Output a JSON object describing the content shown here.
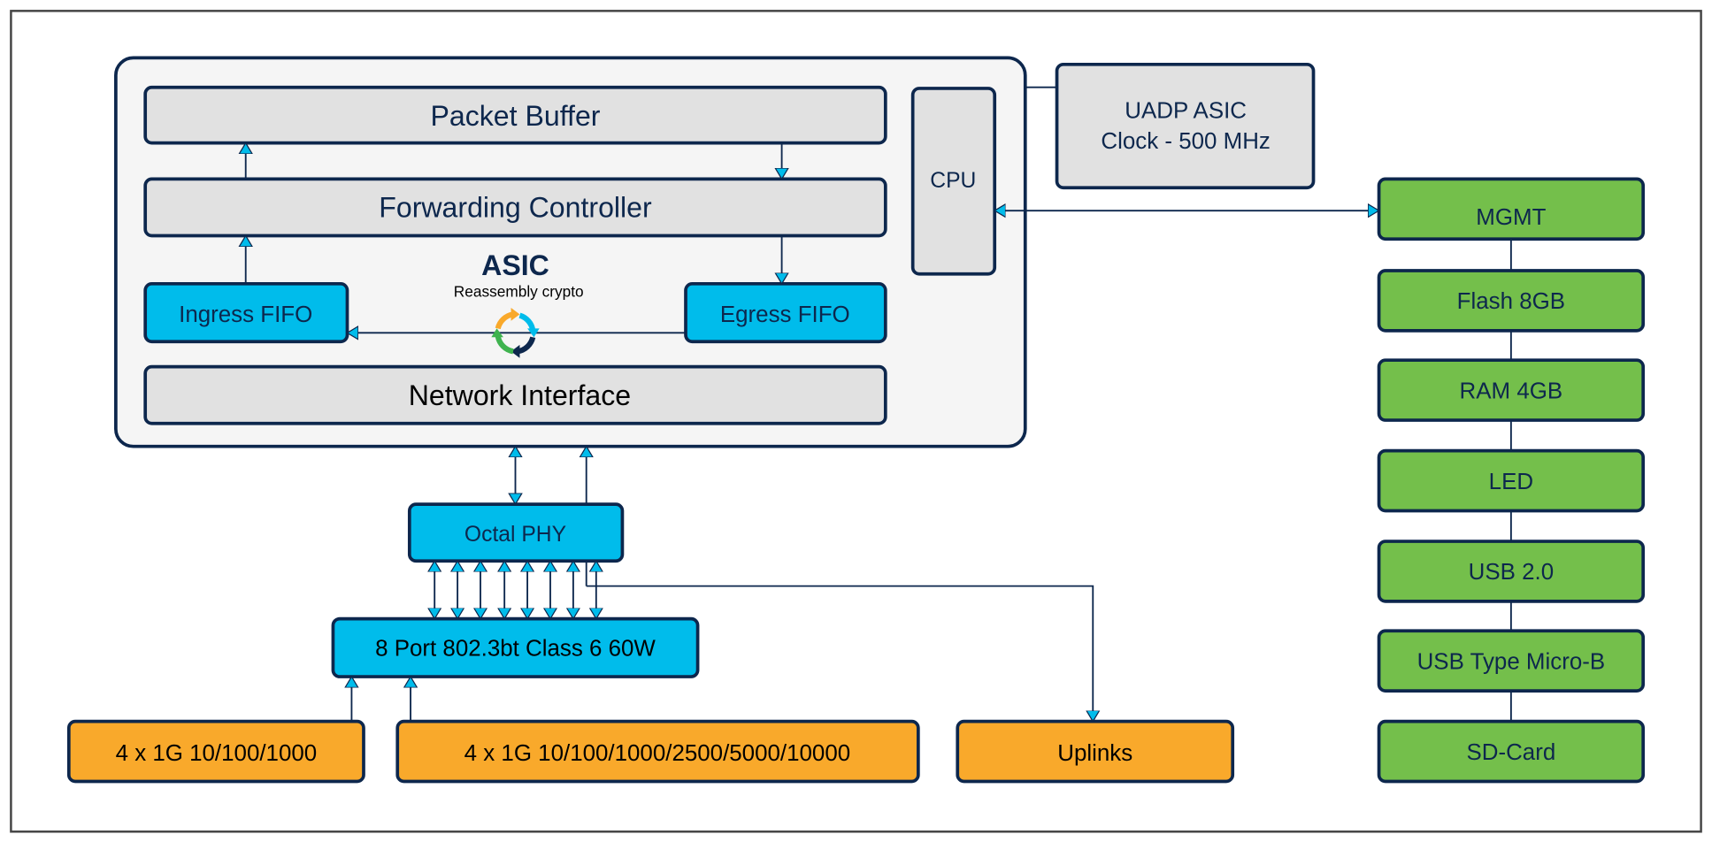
{
  "colors": {
    "outline": "#0d274d",
    "gray_block": "#e1e1e1",
    "asic_bg": "#f5f5f5",
    "cyan_block": "#00bceb",
    "green_block": "#74bf4b",
    "orange_block": "#f9a92b"
  },
  "asic": {
    "title": "ASIC",
    "subtitle": "Reassembly crypto",
    "packet_buffer": "Packet Buffer",
    "forwarding_controller": "Forwarding Controller",
    "ingress_fifo": "Ingress FIFO",
    "egress_fifo": "Egress FIFO",
    "network_interface": "Network Interface",
    "cpu": "CPU",
    "crypto_icon": "recycle-cycle-icon"
  },
  "uadp": {
    "line1": "UADP ASIC",
    "line2": "Clock - 500 MHz"
  },
  "peripherals": [
    "MGMT",
    "Flash 8GB",
    "RAM 4GB",
    "LED",
    "USB 2.0",
    "USB Type Micro-B",
    "SD-Card"
  ],
  "octal_phy": "Octal PHY",
  "poe": "8 Port 802.3bt Class 6 60W",
  "ports": [
    "4 x 1G 10/100/1000",
    "4 x 1G 10/100/1000/2500/5000/10000",
    "Uplinks"
  ]
}
